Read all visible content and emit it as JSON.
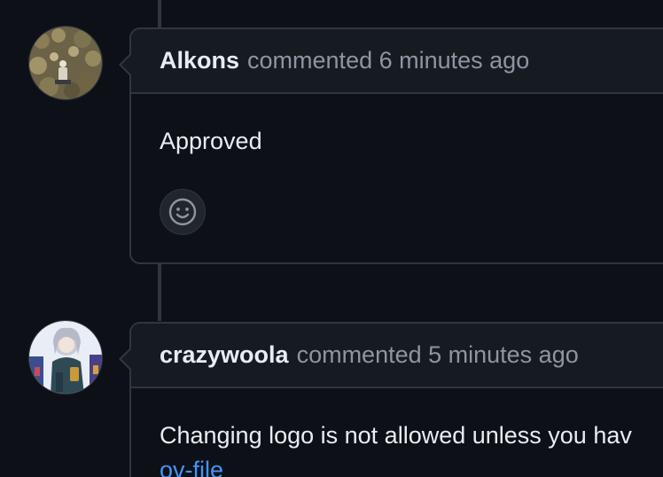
{
  "comments": [
    {
      "author": "Alkons",
      "meta": "commented 6 minutes ago",
      "body": "Approved",
      "avatar_icon": "user-avatar-photo-rocks"
    },
    {
      "author": "crazywoola",
      "meta": "commented 5 minutes ago",
      "body": "Changing logo is not allowed unless you hav",
      "link_fragment": "ov-file",
      "avatar_icon": "user-avatar-anime-character"
    }
  ],
  "reaction": {
    "icon": "smiley-face-icon"
  },
  "colors": {
    "background": "#0d1117",
    "header_bg": "#161b22",
    "border": "#30363d",
    "text": "#e6edf3",
    "muted": "#8d96a0",
    "link": "#4493f8"
  }
}
